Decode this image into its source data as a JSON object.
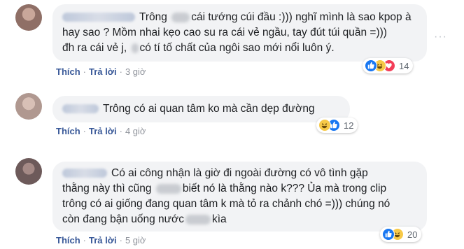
{
  "comments": [
    {
      "lines": [
        [
          "Trông ",
          "cái tướng cúi đầu :))) nghĩ mình là sao kpop à"
        ],
        [
          "hay sao ? Mồm nhai kẹo cao su ra cái vẻ ngầu, tay đút túi quần =)))"
        ],
        [
          "đh ra cái vẻ j, ",
          "có tí tố chất của ngôi sao mới nổi luôn ý."
        ]
      ],
      "like_label": "Thích",
      "reply_label": "Trả lời",
      "time": "3 giờ",
      "reaction_count": "14",
      "reaction_icons": [
        "like-icon",
        "haha-icon",
        "love-icon"
      ]
    },
    {
      "lines": [
        [
          "Trông có ai quan tâm ko mà cần dẹp đường"
        ]
      ],
      "like_label": "Thích",
      "reply_label": "Trả lời",
      "time": "4 giờ",
      "reaction_count": "12",
      "reaction_icons": [
        "haha-icon",
        "like-icon"
      ]
    },
    {
      "lines": [
        [
          "Có ai công nhận là giờ đi ngoài đường có vô tình gặp"
        ],
        [
          "thằng này thì cũng ",
          "biết nó là thằng nào k??? Ủa mà trong clip"
        ],
        [
          "trông có ai giống đang quan tâm k mà tỏ ra chảnh chó =))) chúng nó"
        ],
        [
          "còn đang bận uống nước",
          "kìa"
        ]
      ],
      "like_label": "Thích",
      "reply_label": "Trả lời",
      "time": "5 giờ",
      "reaction_count": "20",
      "reaction_icons": [
        "like-icon",
        "haha-icon"
      ]
    }
  ],
  "more_options": "···",
  "colors": {
    "bubble": "#f2f3f5",
    "link": "#385898",
    "like": "#1877f2",
    "haha": "#f7c948",
    "love": "#f33e58"
  }
}
